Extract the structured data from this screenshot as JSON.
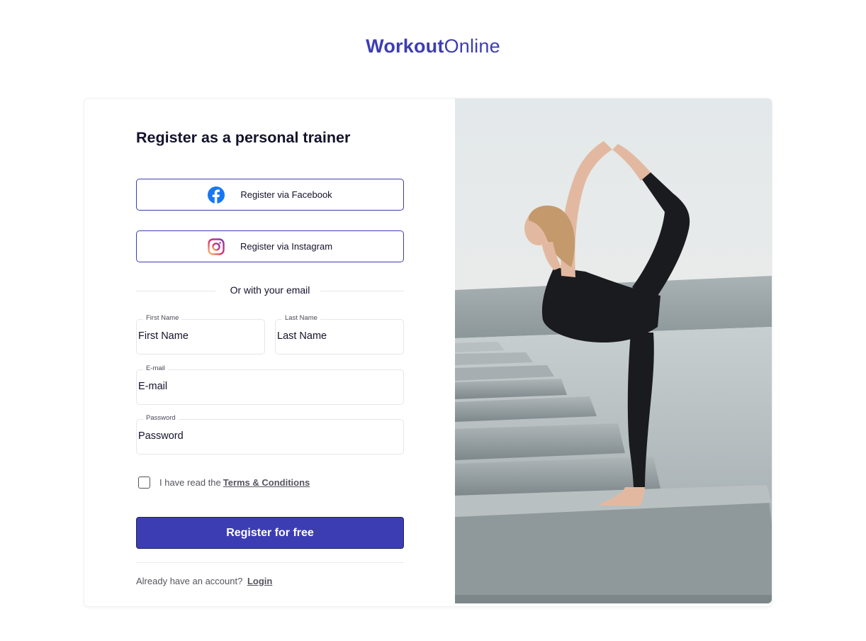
{
  "brand": {
    "part1": "Workout",
    "part2": "Online",
    "accent": "#3d3db3"
  },
  "form": {
    "title": "Register as a personal trainer",
    "facebook_label": "Register via Facebook",
    "instagram_label": "Register via Instagram",
    "divider_text": "Or with your email",
    "fields": {
      "first_name": {
        "label": "First Name",
        "value": "First Name"
      },
      "last_name": {
        "label": "Last Name",
        "value": "Last Name"
      },
      "email": {
        "label": "E-mail",
        "value": "E-mail"
      },
      "password": {
        "label": "Password",
        "value": "Password"
      }
    },
    "terms_prefix": "I have read the",
    "terms_link": "Terms & Conditions",
    "terms_checked": false,
    "submit_label": "Register for free",
    "login_prefix": "Already have an account?",
    "login_link": "Login"
  },
  "icons": {
    "facebook": "facebook-icon",
    "instagram": "instagram-icon"
  }
}
